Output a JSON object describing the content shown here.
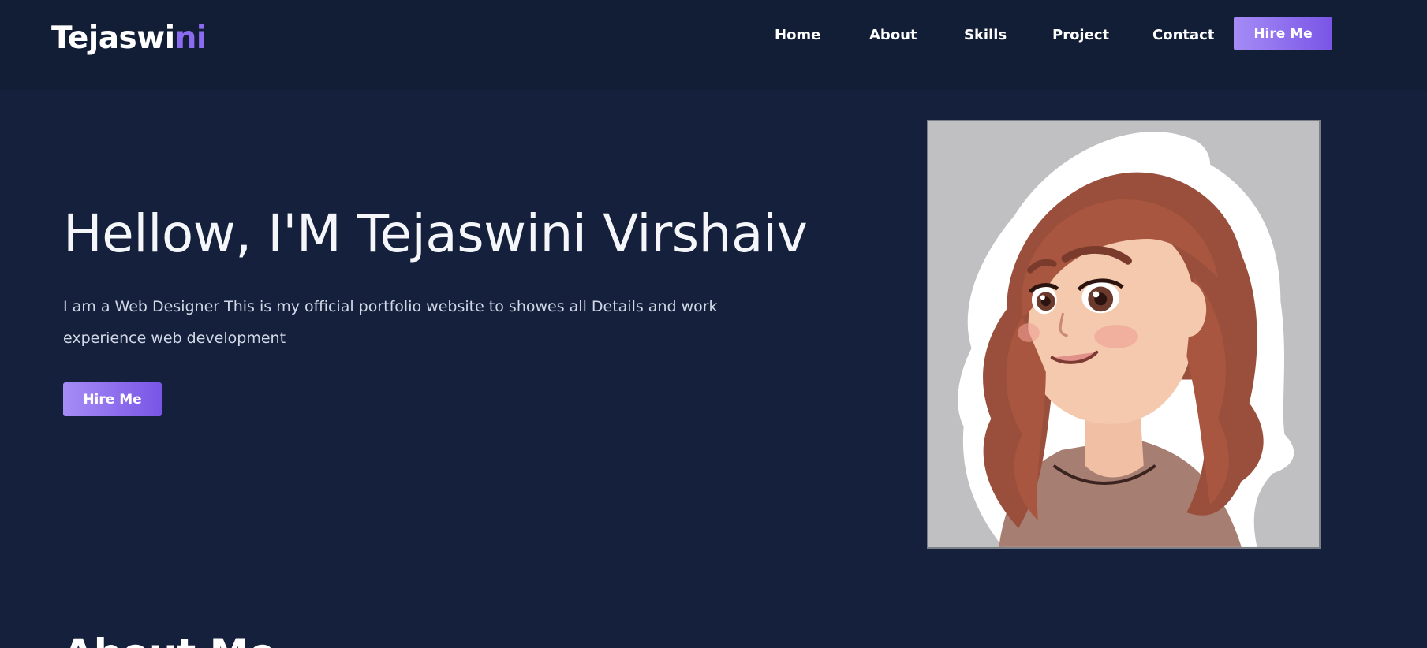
{
  "nav": {
    "logo_main": "Tejaswi",
    "logo_accent": "ni",
    "links": [
      "Home",
      "About",
      "Skills",
      "Project",
      "Contact"
    ],
    "cta_label": "Hire Me"
  },
  "hero": {
    "title": "Hellow, I'M Tejaswini Virshaiv",
    "description": "I am a Web Designer This is my official portfolio website to showes all Details and work experience web development",
    "cta_label": "Hire Me"
  },
  "portrait": {
    "icon": "cartoon-girl-avatar"
  },
  "next_section": {
    "title": "About Me"
  },
  "colors": {
    "background": "#14203c",
    "navbar": "#121d36",
    "accent": "#8b6cf0",
    "button_gradient_start": "#a58cf6",
    "button_gradient_end": "#7a55e6"
  }
}
